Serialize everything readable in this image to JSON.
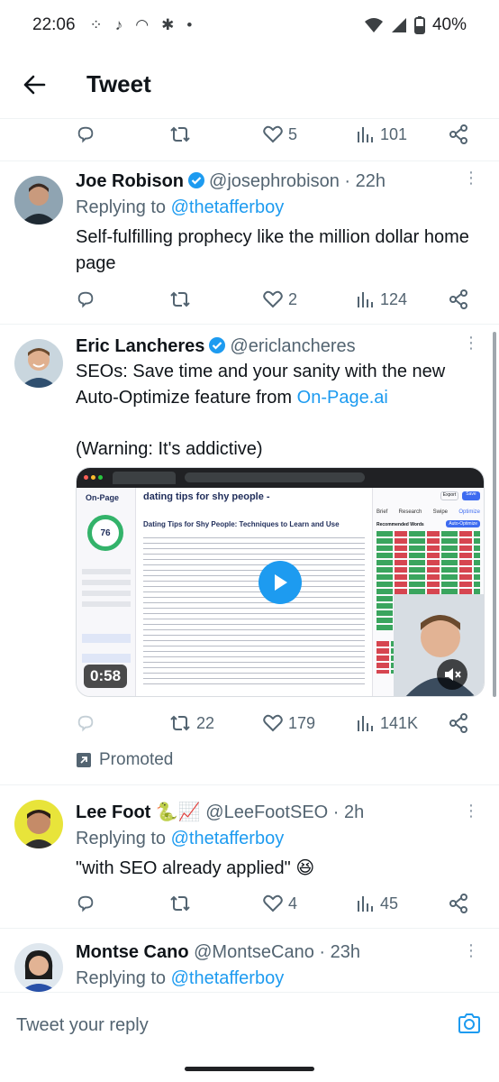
{
  "status_bar": {
    "time": "22:06",
    "battery": "40%"
  },
  "header": {
    "title": "Tweet"
  },
  "top_actions": {
    "retweets": "",
    "likes": "5",
    "views": "101"
  },
  "tweets": [
    {
      "name": "Joe Robison",
      "handle": "@josephrobison",
      "time": "· 22h",
      "replying_label": "Replying to",
      "replying_to": "@thetafferboy",
      "text": "Self-fulfilling prophecy like the million dollar home page",
      "replies": "",
      "retweets": "",
      "likes": "2",
      "views": "124"
    },
    {
      "name": "Eric Lancheres",
      "handle": "@ericlancheres",
      "text1": "SEOs: Save time and your sanity with the new Auto-Optimize feature from ",
      "link": "On-Page.ai",
      "text2": "(Warning: It's addictive)",
      "video_duration": "0:58",
      "video": {
        "brand": "On-Page",
        "doc_title": "dating tips for shy people -",
        "heading": "Dating Tips for Shy People: Techniques to Learn and Use",
        "score": "76",
        "tabs": [
          "Brief",
          "Research",
          "Swipe",
          "Optimize"
        ],
        "recommended": "Recommended Words",
        "auto_optimize": "Auto-Optimize",
        "export": "Export",
        "save": "Save"
      },
      "retweets": "22",
      "likes": "179",
      "views": "141K",
      "promoted": "Promoted"
    },
    {
      "name": "Lee Foot",
      "emoji": "🐍📈",
      "handle": "@LeeFootSEO",
      "time": "· 2h",
      "replying_label": "Replying to",
      "replying_to": "@thetafferboy",
      "text": "\"with SEO already applied\" 😆",
      "likes": "4",
      "views": "45"
    },
    {
      "name": "Montse Cano",
      "handle": "@MontseCano",
      "time": "· 23h",
      "replying_label": "Replying to",
      "replying_to": "@thetafferboy"
    }
  ],
  "reply_bar": {
    "placeholder": "Tweet your reply"
  },
  "colors": {
    "accent": "#1d9bf0",
    "muted": "#536471",
    "divider": "#eff3f4"
  }
}
